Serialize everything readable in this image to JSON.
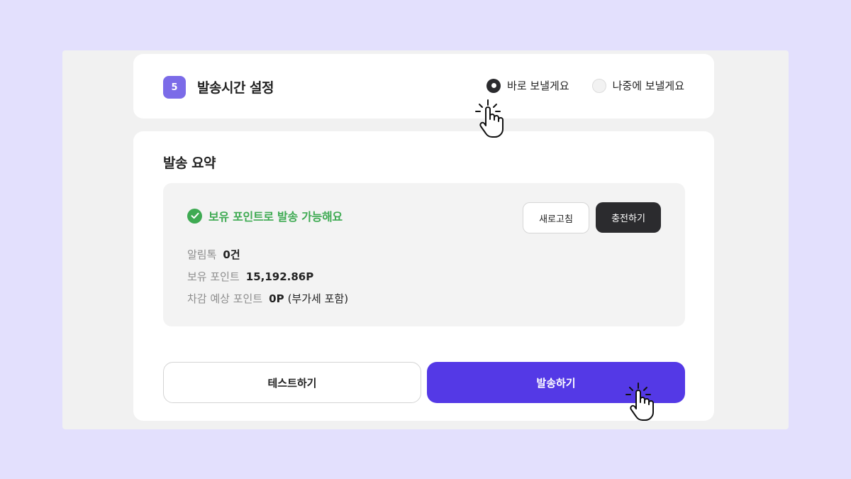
{
  "step": {
    "number": "5",
    "title": "발송시간 설정"
  },
  "send_time": {
    "options": [
      {
        "label": "바로 보낼게요",
        "selected": true
      },
      {
        "label": "나중에 보낼게요",
        "selected": false
      }
    ]
  },
  "summary": {
    "title": "발송 요약",
    "status_text": "보유 포인트로 발송 가능해요",
    "refresh_label": "새로고침",
    "charge_label": "충전하기",
    "rows": [
      {
        "key": "알림톡",
        "value": "0건",
        "suffix": ""
      },
      {
        "key": "보유 포인트",
        "value": "15,192.86P",
        "suffix": ""
      },
      {
        "key": "차감 예상 포인트",
        "value": "0P",
        "suffix": "(부가세 포함)"
      }
    ]
  },
  "actions": {
    "test_label": "테스트하기",
    "send_label": "발송하기"
  },
  "colors": {
    "accent": "#5439e6",
    "badge": "#7b6be8",
    "success": "#3eaa52",
    "dark_button": "#2b2b2e",
    "background": "#e3e0fd"
  },
  "icons": [
    "check-circle-icon",
    "hand-pointer-icon"
  ]
}
